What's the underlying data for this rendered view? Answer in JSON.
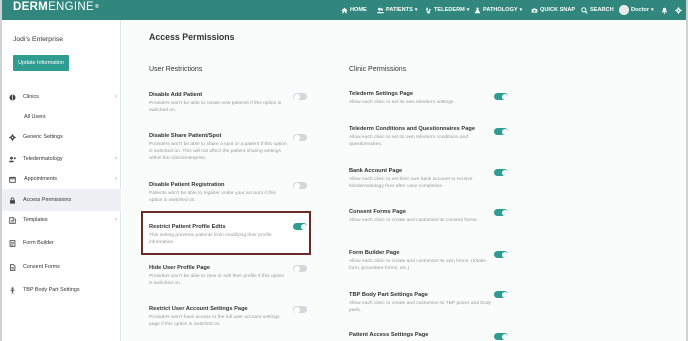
{
  "topbar": {
    "logo_bold": "DERM",
    "logo_regular": "ENGINE",
    "logo_mark": "®",
    "nav": [
      {
        "label": "HOME",
        "icon": "home-icon"
      },
      {
        "label": "PATIENTS",
        "icon": "users-icon",
        "dropdown": true
      },
      {
        "label": "TELEDERM",
        "icon": "telederm-icon",
        "dropdown": true
      },
      {
        "label": "PATHOLOGY",
        "icon": "pathology-icon",
        "dropdown": true
      },
      {
        "label": "QUICK SNAP",
        "icon": "camera-icon"
      },
      {
        "label": "SEARCH",
        "icon": "search-icon"
      }
    ],
    "user_label": "Doctor",
    "bell_icon": "bell-icon",
    "settings_icon": "gear-icon"
  },
  "sidebar": {
    "enterprise_name": "Jodi's Enterprise",
    "update_button": "Update Information",
    "items": [
      {
        "label": "Clinics",
        "icon": "clinic-icon",
        "chevron": true
      },
      {
        "label": "All Users",
        "icon": "",
        "chevron": false
      },
      {
        "label": "Generic Settings",
        "icon": "gear-icon",
        "chevron": false
      },
      {
        "label": "Teledermatology",
        "icon": "telederm-icon",
        "chevron": true
      },
      {
        "label": "Appointments",
        "icon": "calendar-icon",
        "chevron": true
      },
      {
        "label": "Access Permissions",
        "icon": "lock-icon",
        "chevron": false,
        "active": true
      },
      {
        "label": "Templates",
        "icon": "template-icon",
        "chevron": true
      },
      {
        "label": "Form Builder",
        "icon": "form-icon",
        "chevron": false
      },
      {
        "label": "Consent Forms",
        "icon": "document-icon",
        "chevron": false
      },
      {
        "label": "TBP Body Part Settings",
        "icon": "body-icon",
        "chevron": false
      }
    ]
  },
  "main": {
    "title": "Access Permissions",
    "user_restrictions": {
      "heading": "User Restrictions",
      "settings": [
        {
          "title": "Disable Add Patient",
          "desc": "Providers won't be able to create new patients if this option is switched on.",
          "on": false
        },
        {
          "title": "Disable Share Patient/Spot",
          "desc": "Providers won't be able to share a spot or a patient if this option is switched on. This will not affect the patient sharing settings within the clinic/enterprise.",
          "on": false
        },
        {
          "title": "Disable Patient Registration",
          "desc": "Patients won't be able to register under your account if this option is switched on.",
          "on": false
        },
        {
          "title": "Restrict Patient Profile Edits",
          "desc": "This setting prevents patients from modifying their profile information.",
          "on": true
        },
        {
          "title": "Hide User Profile Page",
          "desc": "Providers won't be able to view or edit their profile if this option is switched on.",
          "on": false
        },
        {
          "title": "Restrict User Account Settings Page",
          "desc": "Providers won't have access to the full user account settings page if this option is switched on.",
          "on": false
        }
      ]
    },
    "clinic_permissions": {
      "heading": "Clinic Permissions",
      "settings": [
        {
          "title": "Telederm Settings Page",
          "desc": "Allow each clinic to set its own telederm settings.",
          "on": true
        },
        {
          "title": "Telederm Conditions and Questionnaires Page",
          "desc": "Allow each clinic to set its own telederm conditions and questionnaires.",
          "on": true
        },
        {
          "title": "Bank Account Page",
          "desc": "Allow each clinic to set their own bank account to receive teledermatology fees after case completion.",
          "on": true
        },
        {
          "title": "Consent Forms Page",
          "desc": "Allow each clinic to create and customize its consent forms.",
          "on": true
        },
        {
          "title": "Form Builder Page",
          "desc": "Allow each clinic to create and customize its own forms. (Intake form, procedure forms, etc.)",
          "on": true
        },
        {
          "title": "TBP Body Part Settings Page",
          "desc": "Allow each clinic to create and customize its TBP poses and body parts.",
          "on": true
        },
        {
          "title": "Patient Access Settings Page",
          "desc": "",
          "on": true
        }
      ]
    }
  },
  "colors": {
    "topbar": "#31877d",
    "accent": "#2e9c91",
    "highlight_border": "#6a2b26"
  }
}
